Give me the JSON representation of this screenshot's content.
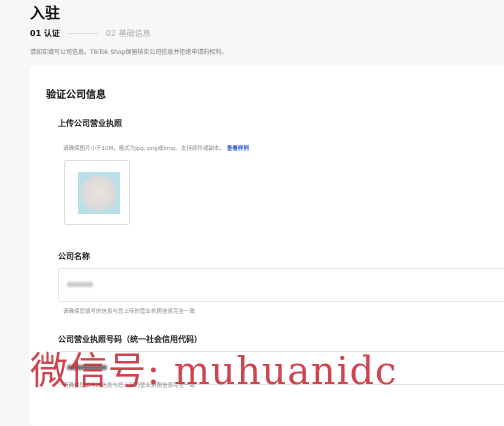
{
  "page": {
    "title": "入驻",
    "steps": [
      {
        "label": "01 认证"
      },
      {
        "label": "02 基础信息"
      }
    ],
    "subtitle": "请如实填写公司信息。TikTok Shop保留核实公司信息并拒绝申请的权利。"
  },
  "card": {
    "title": "验证公司信息",
    "license_upload": {
      "label": "上传公司营业执照",
      "hint": "请确保图片小于10M，格式为jpg, png或bmp。支持原件或副本。",
      "hint_link": "查看样例"
    },
    "company_name": {
      "label": "公司名称",
      "hint": "请确保您填写的信息与您上传的营业执照信息完全一致"
    },
    "license_number": {
      "label": "公司营业执照号码（统一社会信用代码）",
      "hint": "请确保您填写的信息与您上传的营业执照信息完全一致"
    }
  },
  "watermark": "微信号: muhuanidc",
  "colors": {
    "link": "#2e5bd8",
    "watermark": "#c8323c",
    "background": "#f6f7f9"
  }
}
